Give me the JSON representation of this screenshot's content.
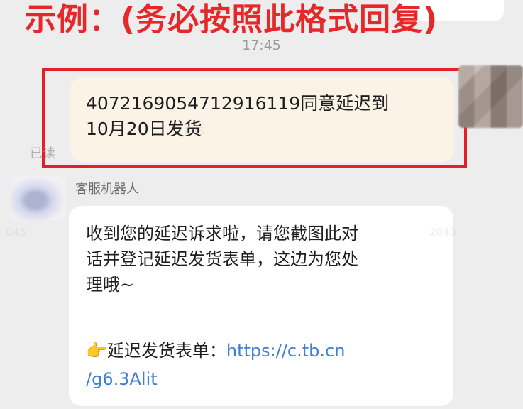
{
  "banner": {
    "text": "示例：(务必按照此格式回复)"
  },
  "chat": {
    "time": "17:45",
    "my_message": {
      "line1": "407216905471291611​9同意延迟到",
      "line2": "10月20日发货"
    },
    "read_status": "已读",
    "bot": {
      "name": "客服机器人",
      "line1": "收到您的延迟诉求啦，请您截图此对",
      "line2": "话并登记延迟发货表单，这边为您处",
      "line3": "理哦~",
      "link_emoji": "👉",
      "link_label": "延迟发货表单：",
      "link_url_part1": "https://c.tb.cn",
      "link_url_part2": "/g6.3Alit"
    }
  },
  "watermarks": [
    "045",
    "045",
    "2045"
  ],
  "colors": {
    "banner": "#e5292b",
    "highlight": "#e3202a",
    "link": "#3f7fd6",
    "my_bubble": "#fcf3e7",
    "background": "#ededed"
  }
}
